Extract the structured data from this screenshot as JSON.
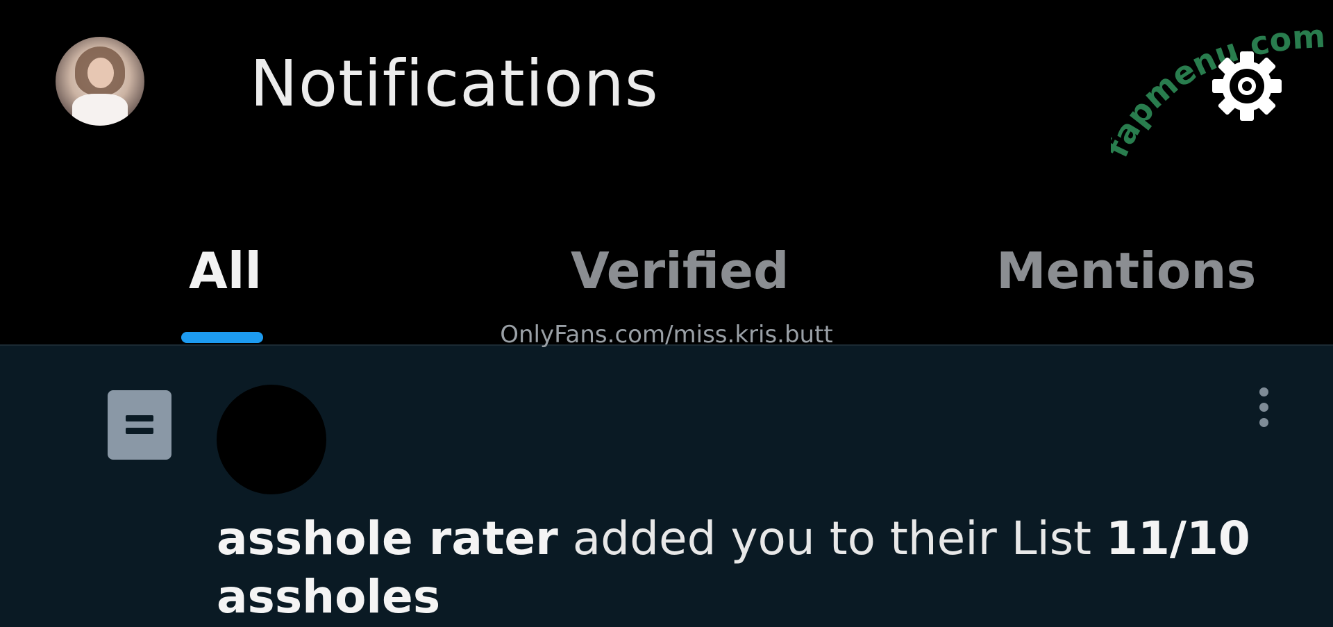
{
  "header": {
    "title": "Notifications",
    "avatar_icon": "user-avatar",
    "settings_icon": "gear-icon"
  },
  "tabs": [
    {
      "label": "All",
      "active": true
    },
    {
      "label": "Verified",
      "active": false
    },
    {
      "label": "Mentions",
      "active": false
    }
  ],
  "watermark": {
    "url": "OnlyFans.com/miss.kris.butt",
    "brand": "fapmenu.com",
    "brand_color": "#2e8b57"
  },
  "notification": {
    "type_icon": "list-icon",
    "actor_name": "asshole rater",
    "action_text": " added you to their List ",
    "list_name": "11/10 assholes",
    "menu_icon": "more-vertical-icon"
  },
  "colors": {
    "background": "#000000",
    "panel": "#0a1a24",
    "accent": "#1d9bf0",
    "tab_inactive": "#8b8e92"
  }
}
